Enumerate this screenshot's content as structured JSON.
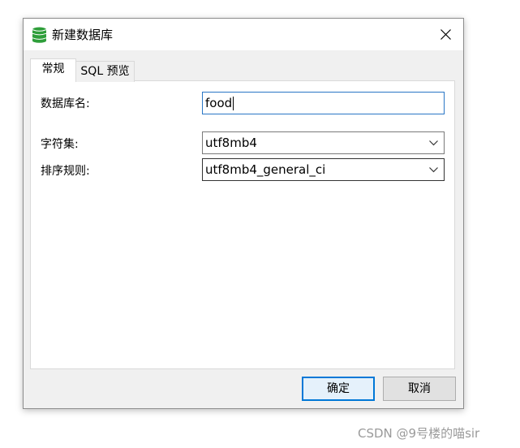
{
  "dialog": {
    "title": "新建数据库",
    "title_icon": "database-icon",
    "close_icon": "close-icon"
  },
  "tabs": [
    {
      "label": "常规",
      "active": true
    },
    {
      "label": "SQL 预览",
      "active": false
    }
  ],
  "form": {
    "db_name_label": "数据库名:",
    "db_name_value": "food",
    "charset_label": "字符集:",
    "charset_value": "utf8mb4",
    "collation_label": "排序规则:",
    "collation_value": "utf8mb4_general_ci"
  },
  "buttons": {
    "ok_label": "确定",
    "cancel_label": "取消"
  },
  "watermark": "CSDN @9号楼的喵sir",
  "colors": {
    "accent": "#0078d7",
    "db_icon": "#2e9e3a",
    "dialog_bg": "#f0f0f0"
  }
}
